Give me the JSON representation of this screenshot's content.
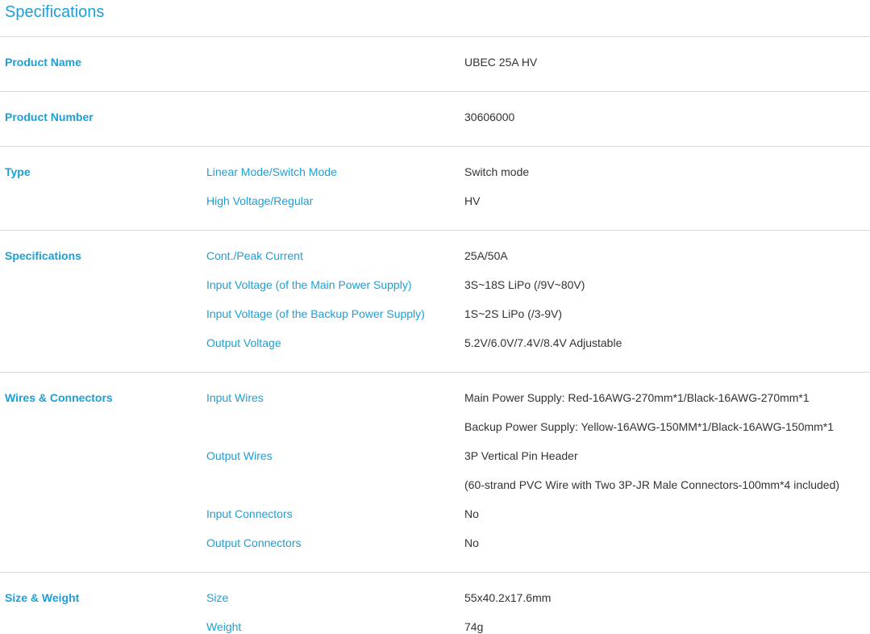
{
  "title": "Specifications",
  "sections": [
    {
      "category": "Product Name",
      "rows": [
        {
          "label": "",
          "value": "UBEC 25A HV"
        }
      ]
    },
    {
      "category": "Product Number",
      "rows": [
        {
          "label": "",
          "value": "30606000"
        }
      ]
    },
    {
      "category": "Type",
      "rows": [
        {
          "label": "Linear Mode/Switch Mode",
          "value": "Switch mode"
        },
        {
          "label": "High Voltage/Regular",
          "value": "HV"
        }
      ]
    },
    {
      "category": "Specifications",
      "rows": [
        {
          "label": "Cont./Peak Current",
          "value": "25A/50A"
        },
        {
          "label": "Input Voltage (of the Main Power Supply)",
          "value": "3S~18S LiPo (/9V~80V)"
        },
        {
          "label": "Input Voltage (of the Backup Power Supply)",
          "value": "1S~2S LiPo (/3-9V)"
        },
        {
          "label": "Output Voltage",
          "value": "5.2V/6.0V/7.4V/8.4V Adjustable"
        }
      ]
    },
    {
      "category": "Wires & Connectors",
      "rows": [
        {
          "label": "Input Wires",
          "value": "Main Power Supply: Red-16AWG-270mm*1/Black-16AWG-270mm*1"
        },
        {
          "label": "",
          "value": "Backup Power Supply: Yellow-16AWG-150MM*1/Black-16AWG-150mm*1"
        },
        {
          "label": "Output Wires",
          "value": "3P Vertical Pin Header"
        },
        {
          "label": "",
          "value": "(60-strand PVC Wire with Two 3P-JR Male Connectors-100mm*4 included)"
        },
        {
          "label": "Input Connectors",
          "value": "No"
        },
        {
          "label": "Output Connectors",
          "value": "No"
        }
      ]
    },
    {
      "category": "Size & Weight",
      "rows": [
        {
          "label": "Size",
          "value": "55x40.2x17.6mm"
        },
        {
          "label": "Weight",
          "value": "74g"
        }
      ]
    }
  ]
}
